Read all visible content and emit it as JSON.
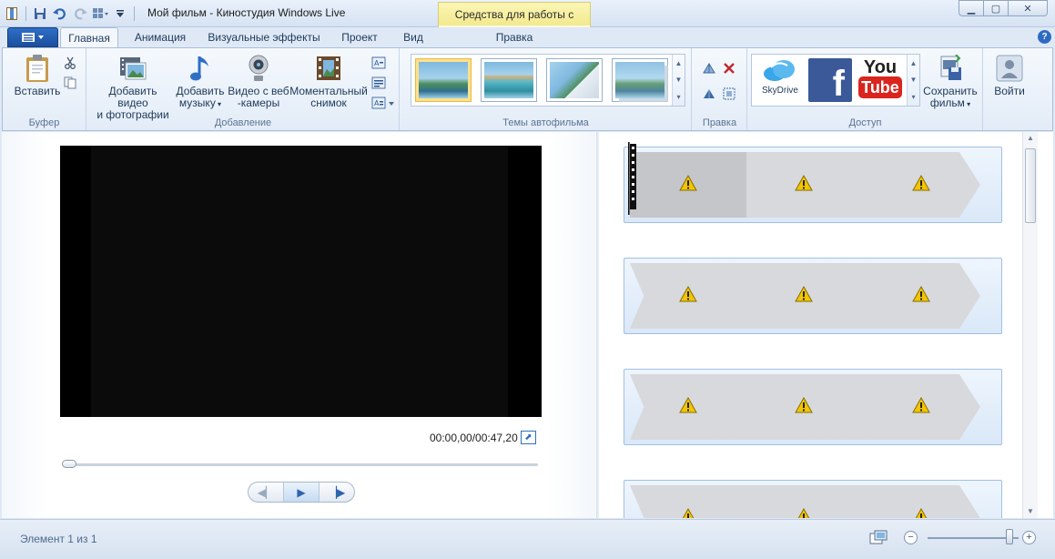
{
  "window": {
    "title": "Мой фильм - Киностудия Windows Live",
    "context_tab": "Средства для работы с видео",
    "controls": [
      "minimize-icon",
      "maximize-icon",
      "close-icon"
    ]
  },
  "tabs": [
    {
      "label": "Главная",
      "active": true
    },
    {
      "label": "Анимация",
      "active": false
    },
    {
      "label": "Визуальные эффекты",
      "active": false
    },
    {
      "label": "Проект",
      "active": false
    },
    {
      "label": "Вид",
      "active": false
    },
    {
      "label": "Правка",
      "active": false
    }
  ],
  "ribbon": {
    "clipboard": {
      "label": "Буфер",
      "paste": "Вставить"
    },
    "add": {
      "label": "Добавление",
      "add_video_l1": "Добавить видео",
      "add_video_l2": "и фотографии",
      "add_music_l1": "Добавить",
      "add_music_l2": "музыку",
      "webcam_l1": "Видео с веб",
      "webcam_l2": "-камеры",
      "snapshot_l1": "Моментальный",
      "snapshot_l2": "снимок"
    },
    "themes": {
      "label": "Темы автофильма",
      "count": 4,
      "selected_index": 0
    },
    "edit": {
      "label": "Правка"
    },
    "share": {
      "label": "Доступ",
      "skydrive": "SkyDrive",
      "facebook": "f",
      "youtube_1": "You",
      "youtube_2": "Tube",
      "save_l1": "Сохранить",
      "save_l2": "фильм"
    },
    "signin": "Войти"
  },
  "preview": {
    "timecode": "00:00,00/00:47,20",
    "seek_position": 0.0
  },
  "storyboard": {
    "clips": [
      {
        "warnings": 3
      },
      {
        "warnings": 3
      },
      {
        "warnings": 3
      },
      {
        "warnings": 3
      }
    ]
  },
  "statusbar": {
    "text": "Элемент 1 из 1",
    "zoom_minus": "−",
    "zoom_plus": "+",
    "zoom_level": 0.9
  },
  "colors": {
    "accent": "#2d6bc2",
    "context_tab": "#f2e98e",
    "warning": "#f2c500"
  }
}
